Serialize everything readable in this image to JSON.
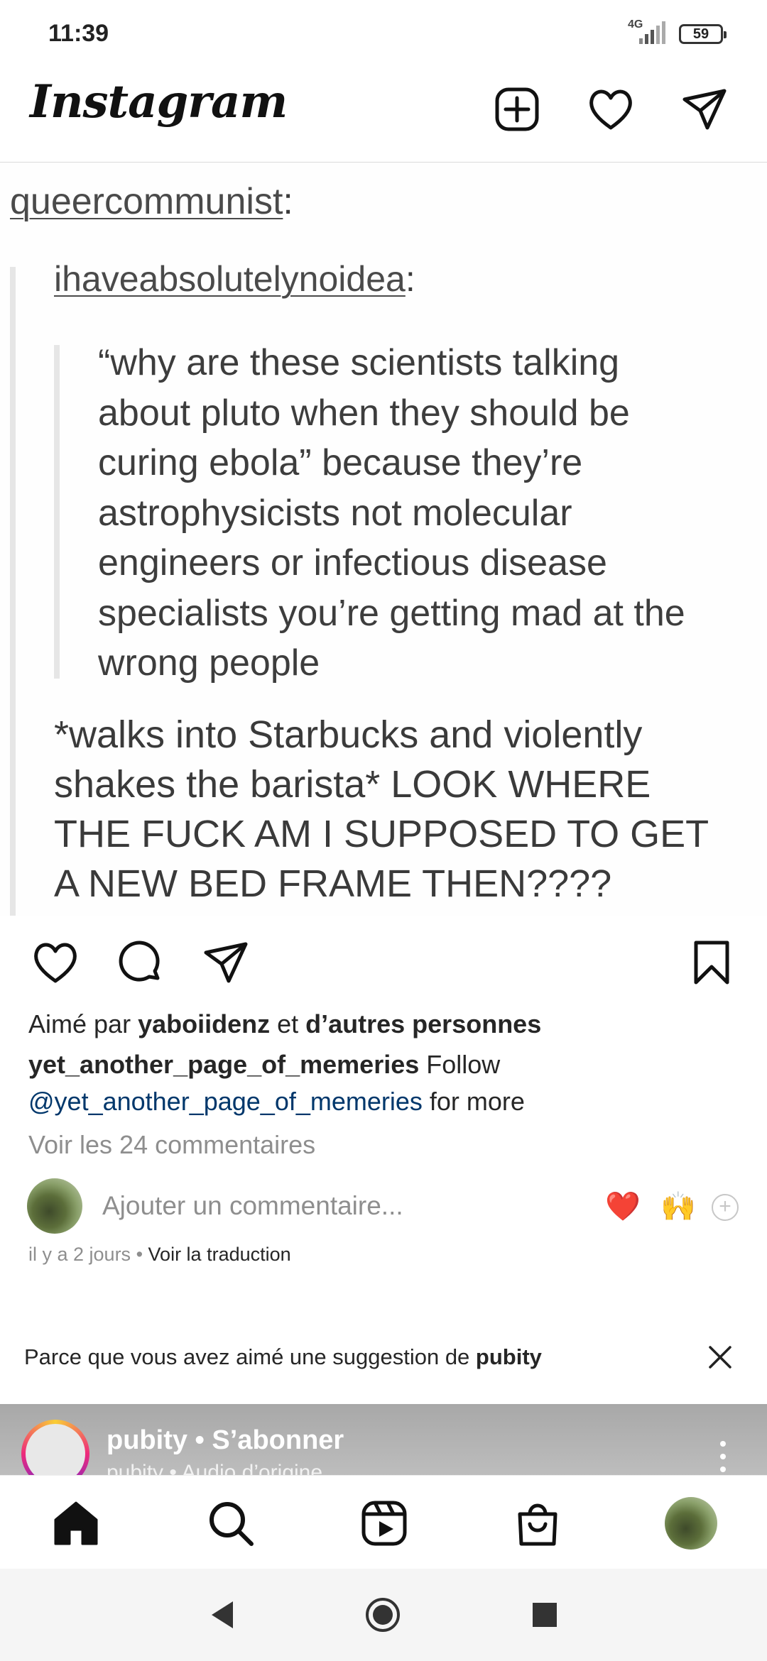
{
  "status_bar": {
    "time": "11:39",
    "network": "4G",
    "battery": "59"
  },
  "header": {
    "logo": "Instagram",
    "icons": [
      "new-post-icon",
      "heart-icon",
      "direct-message-icon"
    ]
  },
  "post_image": {
    "user1": "queercommunist",
    "user2": "ihaveabsolutelynoidea",
    "colon": ":",
    "quote_lines": [
      "“why are these scientists talking",
      "about pluto when they should be",
      "curing ebola” because they’re",
      "astrophysicists not molecular",
      "engineers or infectious disease",
      "specialists you’re getting mad at the",
      "wrong people"
    ],
    "reply_lines": [
      "*walks into Starbucks and violently",
      "shakes the barista* LOOK WHERE",
      "THE FUCK AM I SUPPOSED TO GET",
      "A NEW BED FRAME THEN????"
    ]
  },
  "post": {
    "likes_prefix": "Aimé par ",
    "likes_user": "yaboiidenz",
    "likes_middle": " et ",
    "likes_others": "d’autres personnes",
    "caption_user": "yet_another_page_of_memeries",
    "caption_text": " Follow",
    "caption_mention": "@yet_another_page_of_memeries",
    "caption_suffix": " for more",
    "view_comments": "Voir les 24 commentaires",
    "comment_placeholder": "Ajouter un commentaire...",
    "quick_emojis": [
      "❤️",
      "🙌"
    ],
    "time_ago": "il y a 2 jours",
    "separator": " • ",
    "translate": "Voir la traduction"
  },
  "suggestion": {
    "text": "Parce que vous avez aimé une suggestion de ",
    "account": "pubity"
  },
  "next_post": {
    "name": "pubity • S’abonner",
    "subtitle": "pubity • Audio d’origine"
  }
}
